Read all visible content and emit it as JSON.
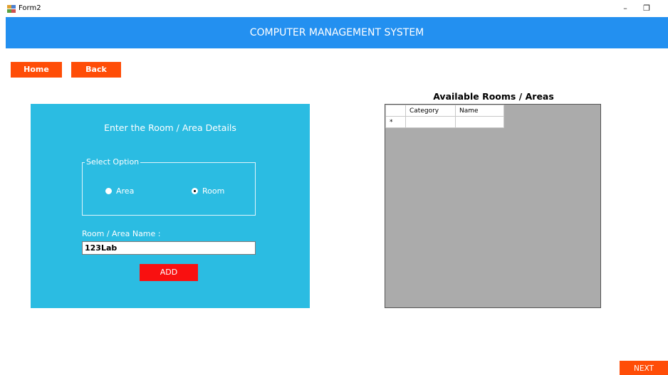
{
  "window": {
    "title": "Form2",
    "minimize_glyph": "–",
    "restore_glyph": "❐"
  },
  "header": {
    "title": "COMPUTER MANAGEMENT SYSTEM"
  },
  "nav": {
    "home_label": "Home",
    "back_label": "Back",
    "next_label": "NEXT"
  },
  "form": {
    "title": "Enter the Room / Area Details",
    "group_legend": "Select Option",
    "options": [
      {
        "label": "Area",
        "checked": false
      },
      {
        "label": "Room",
        "checked": true
      }
    ],
    "name_label": "Room / Area Name :",
    "name_value": "123Lab",
    "add_label": "ADD"
  },
  "grid": {
    "title": "Available Rooms / Areas",
    "columns": [
      "Category",
      "Name"
    ],
    "new_row_marker": "*"
  },
  "colors": {
    "header_bg": "#2390f0",
    "nav_button": "#ff4d07",
    "panel_bg": "#2bbce2",
    "add_button": "#f91010",
    "grid_bg": "#ababab"
  }
}
